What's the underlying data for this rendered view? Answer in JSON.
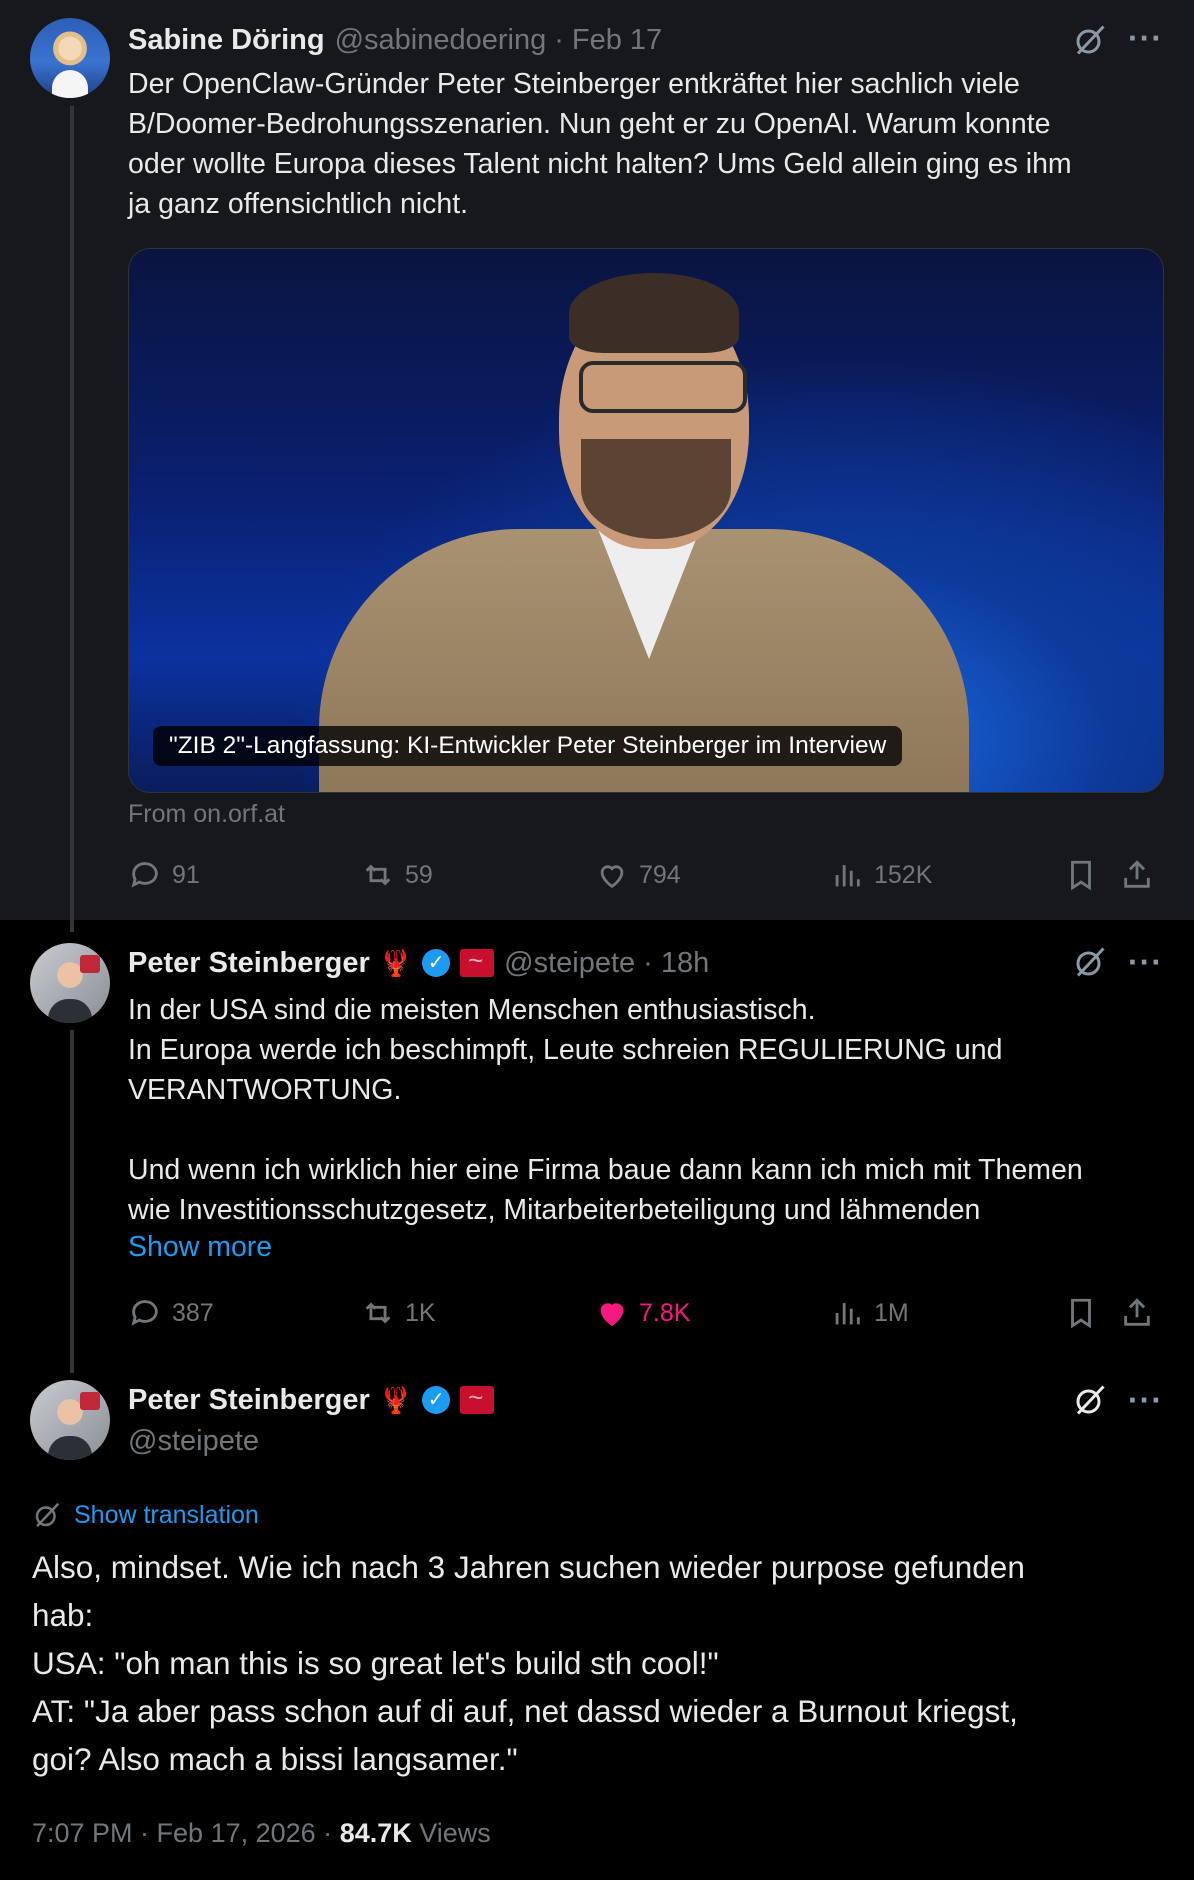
{
  "tweet1": {
    "name": "Sabine Döring",
    "handle": "@sabinedoering",
    "separator": "·",
    "time": "Feb 17",
    "text": "Der OpenClaw-Gründer Peter Steinberger entkräftet hier sachlich viele\nB/Doomer-Bedrohungsszenarien. Nun geht er zu OpenAI. Warum konnte\noder wollte Europa dieses Talent nicht halten? Ums Geld allein ging es ihm\nja ganz offensichtlich nicht.",
    "media_caption": "\"ZIB 2\"-Langfassung: KI-Entwickler Peter Steinberger im Interview",
    "source": "From on.orf.at",
    "replies": "91",
    "reposts": "59",
    "likes": "794",
    "views": "152K"
  },
  "tweet2": {
    "name": "Peter Steinberger",
    "badges": [
      "lobster-emoji",
      "verified-badge",
      "flag-badge"
    ],
    "handle": "@steipete",
    "separator": "·",
    "time": "18h",
    "text": "In der USA sind die meisten Menschen enthusiastisch.\nIn Europa werde ich beschimpft, Leute schreien REGULIERUNG und\nVERANTWORTUNG.\n\nUnd wenn ich wirklich hier eine Firma baue dann kann ich mich mit Themen\nwie Investitionsschutzgesetz, Mitarbeiterbeteiligung und lähmenden",
    "show_more": "Show more",
    "replies": "387",
    "reposts": "1K",
    "likes": "7.8K",
    "views": "1M",
    "liked": true
  },
  "tweet3": {
    "name": "Peter Steinberger",
    "handle": "@steipete",
    "show_translation": "Show translation",
    "text": "Also, mindset. Wie ich nach 3 Jahren suchen wieder purpose gefunden\nhab:\nUSA: \"oh man this is so great let's build sth cool!\"\nAT: \"Ja aber pass schon auf di auf, net dassd wieder a Burnout kriegst,\ngoi? Also mach a bissi langsamer.\"",
    "timestamp": "7:07 PM · Feb 17, 2026 ·",
    "view_count": "84.7K",
    "views_label": "Views"
  },
  "colors": {
    "background": "#000000",
    "panel": "#16181c",
    "text": "#e7e9ea",
    "muted": "#71767b",
    "link": "#1d9bf0",
    "like": "#f91880"
  },
  "icons": [
    "grok-icon",
    "more-icon",
    "reply-icon",
    "repost-icon",
    "like-icon",
    "views-icon",
    "bookmark-icon",
    "share-icon"
  ]
}
